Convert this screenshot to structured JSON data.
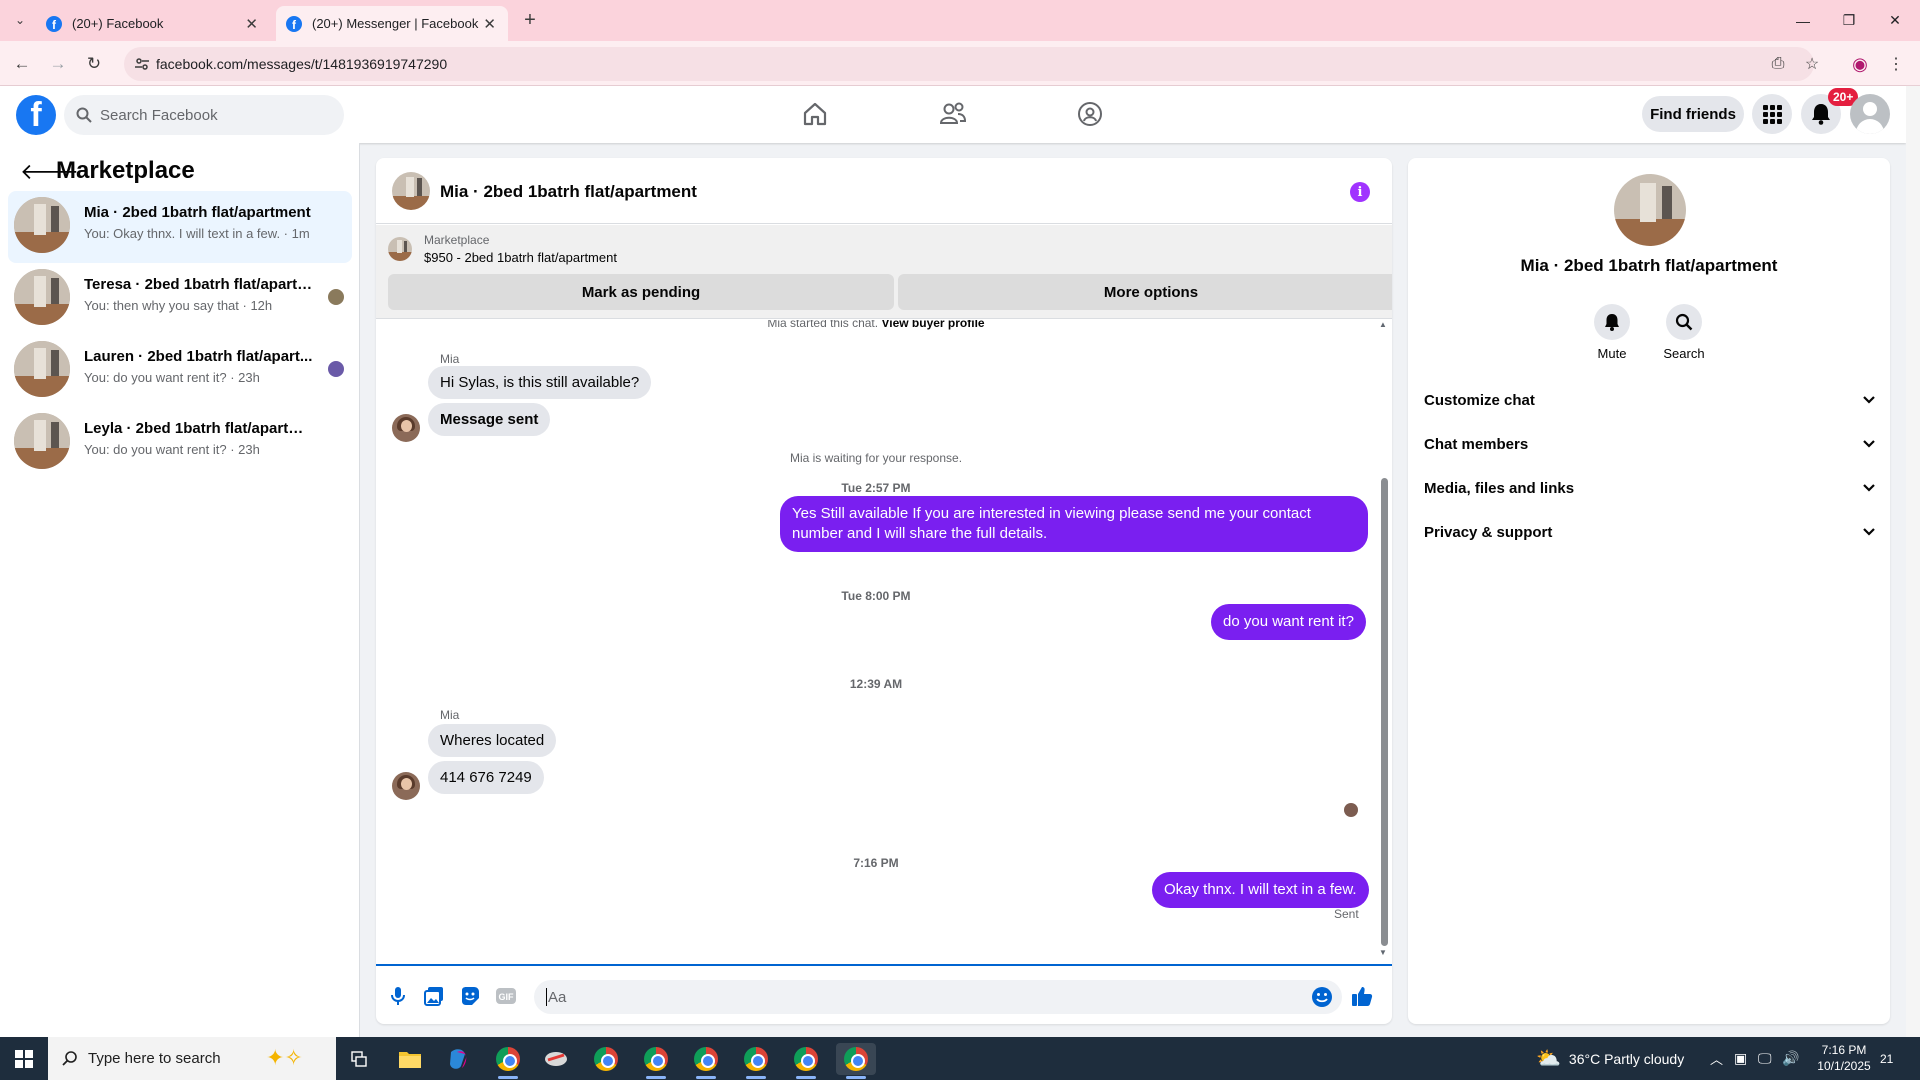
{
  "browser": {
    "tabs": [
      {
        "title": "(20+) Facebook"
      },
      {
        "title": "(20+) Messenger | Facebook"
      }
    ],
    "url": "facebook.com/messages/t/1481936919747290"
  },
  "fb": {
    "search_placeholder": "Search Facebook",
    "find_friends": "Find friends",
    "notif_badge": "20+"
  },
  "left": {
    "title": "Marketplace",
    "conversations": [
      {
        "name": "Mia · 2bed 1batrh flat/apartment",
        "snippet": "You: Okay thnx. I will text in a few. · 1m"
      },
      {
        "name": "Teresa · 2bed 1batrh flat/apartm...",
        "snippet": "You: then why you say that · 12h"
      },
      {
        "name": "Lauren · 2bed 1batrh flat/apart...",
        "snippet": "You: do you want rent it? · 23h"
      },
      {
        "name": "Leyla · 2bed 1batrh flat/apartment",
        "snippet": "You: do you want rent it? · 23h"
      }
    ]
  },
  "chat": {
    "title": "Mia · 2bed 1batrh flat/apartment",
    "marketplace_label": "Marketplace",
    "listing": "$950 - 2bed 1batrh flat/apartment",
    "mark_pending": "Mark as pending",
    "more_options": "More options",
    "started_text": "Mia started this chat.",
    "view_profile": "View buyer profile",
    "sender_name": "Mia",
    "msg1": "Hi Sylas, is this still available?",
    "msg2": "Message sent",
    "waiting": "Mia is waiting for your response.",
    "ts1": "Tue 2:57 PM",
    "out1": "Yes Still available If you are interested in viewing please send me your contact number and I will share the full details.",
    "ts2": "Tue 8:00 PM",
    "out2": "do you want rent it?",
    "ts3": "12:39 AM",
    "msg3": "Wheres located",
    "msg4": "414 676 7249",
    "ts4": "7:16 PM",
    "out3": "Okay thnx. I will text in a few.",
    "sent": "Sent",
    "input_placeholder": "Aa"
  },
  "right": {
    "title": "Mia · 2bed 1batrh flat/apartment",
    "mute": "Mute",
    "search": "Search",
    "rows": [
      "Customize chat",
      "Chat members",
      "Media, files and links",
      "Privacy & support"
    ]
  },
  "taskbar": {
    "search_placeholder": "Type here to search",
    "weather": "36°C  Partly cloudy",
    "time": "7:16 PM",
    "date": "10/1/2025",
    "notifications": "21"
  },
  "colors": {
    "accent": "#7a1ff0",
    "fb_blue": "#1877f2",
    "badge_red": "#e41e3f"
  }
}
